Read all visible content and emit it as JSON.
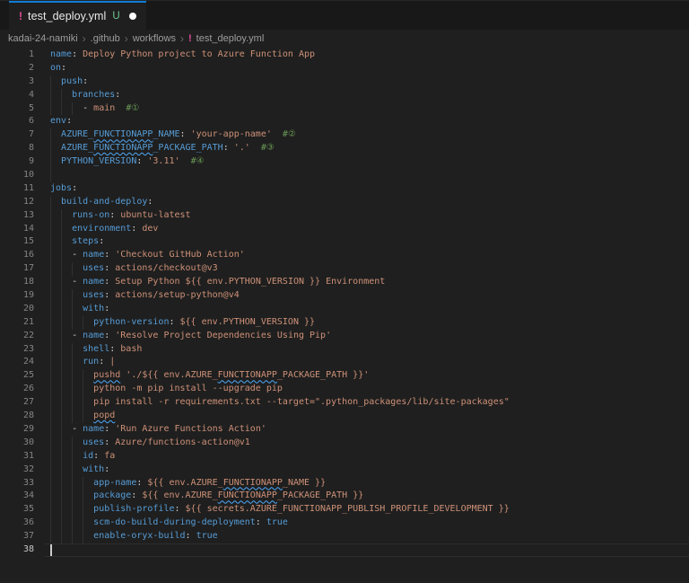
{
  "tab": {
    "icon": "!",
    "label": "test_deploy.yml",
    "git_status": "U"
  },
  "breadcrumb": {
    "separator": "›",
    "items": [
      "kadai-24-namiki",
      ".github",
      "workflows"
    ],
    "file": {
      "icon": "!",
      "label": "test_deploy.yml"
    }
  },
  "colors": {
    "editor_bg": "#1f1f1f",
    "tabbar_bg": "#181818",
    "active_tab_accent": "#0d7cd6",
    "key": "#569cd6",
    "string": "#ce9178",
    "comment": "#6a9955",
    "boolean": "#569cd6",
    "punctuation": "#d4d4d4",
    "squiggle_info": "#4daafc",
    "yaml_icon_pink": "#e64c9c",
    "git_untracked_green": "#73c991",
    "line_number": "#858585",
    "line_number_active": "#c6c6c6"
  },
  "editor": {
    "active_line": 38,
    "lines": [
      {
        "n": 1,
        "g": 0,
        "t": [
          [
            "name",
            "k"
          ],
          [
            ": ",
            "p"
          ],
          [
            "Deploy Python project to Azure Function App",
            "s"
          ]
        ]
      },
      {
        "n": 2,
        "g": 0,
        "t": [
          [
            "on",
            "k"
          ],
          [
            ":",
            "p"
          ]
        ]
      },
      {
        "n": 3,
        "g": 1,
        "t": [
          [
            "  ",
            "w"
          ],
          [
            "push",
            "k"
          ],
          [
            ":",
            "p"
          ]
        ]
      },
      {
        "n": 4,
        "g": 2,
        "t": [
          [
            "    ",
            "w"
          ],
          [
            "branches",
            "k"
          ],
          [
            ":",
            "p"
          ]
        ]
      },
      {
        "n": 5,
        "g": 3,
        "t": [
          [
            "      ",
            "w"
          ],
          [
            "- ",
            "p"
          ],
          [
            "main",
            "s"
          ],
          [
            "  ",
            "w"
          ],
          [
            "#①",
            "c"
          ]
        ]
      },
      {
        "n": 6,
        "g": 0,
        "t": [
          [
            "env",
            "k"
          ],
          [
            ":",
            "p"
          ]
        ]
      },
      {
        "n": 7,
        "g": 1,
        "t": [
          [
            "  ",
            "w"
          ],
          [
            "AZURE_",
            "k"
          ],
          [
            "FUNCTIONAPP",
            "k",
            1
          ],
          [
            "_NAME",
            "k"
          ],
          [
            ": ",
            "p"
          ],
          [
            "'your-app-name'",
            "s"
          ],
          [
            "  ",
            "w"
          ],
          [
            "#②",
            "c"
          ]
        ]
      },
      {
        "n": 8,
        "g": 1,
        "t": [
          [
            "  ",
            "w"
          ],
          [
            "AZURE_",
            "k"
          ],
          [
            "FUNCTIONAPP",
            "k",
            1
          ],
          [
            "_PACKAGE_PATH",
            "k"
          ],
          [
            ": ",
            "p"
          ],
          [
            "'.'",
            "s"
          ],
          [
            "  ",
            "w"
          ],
          [
            "#③",
            "c"
          ]
        ]
      },
      {
        "n": 9,
        "g": 1,
        "t": [
          [
            "  ",
            "w"
          ],
          [
            "PYTHON_VERSION",
            "k"
          ],
          [
            ": ",
            "p"
          ],
          [
            "'3.11'",
            "s"
          ],
          [
            "  ",
            "w"
          ],
          [
            "#④",
            "c"
          ]
        ]
      },
      {
        "n": 10,
        "g": 1,
        "t": []
      },
      {
        "n": 11,
        "g": 0,
        "t": [
          [
            "jobs",
            "k"
          ],
          [
            ":",
            "p"
          ]
        ]
      },
      {
        "n": 12,
        "g": 1,
        "t": [
          [
            "  ",
            "w"
          ],
          [
            "build-and-deploy",
            "k"
          ],
          [
            ":",
            "p"
          ]
        ]
      },
      {
        "n": 13,
        "g": 2,
        "t": [
          [
            "    ",
            "w"
          ],
          [
            "runs-on",
            "k"
          ],
          [
            ": ",
            "p"
          ],
          [
            "ubuntu-latest",
            "s"
          ]
        ]
      },
      {
        "n": 14,
        "g": 2,
        "t": [
          [
            "    ",
            "w"
          ],
          [
            "environment",
            "k"
          ],
          [
            ": ",
            "p"
          ],
          [
            "dev",
            "s"
          ]
        ]
      },
      {
        "n": 15,
        "g": 2,
        "t": [
          [
            "    ",
            "w"
          ],
          [
            "steps",
            "k"
          ],
          [
            ":",
            "p"
          ]
        ]
      },
      {
        "n": 16,
        "g": 2,
        "t": [
          [
            "    ",
            "w"
          ],
          [
            "- ",
            "p"
          ],
          [
            "name",
            "k"
          ],
          [
            ": ",
            "p"
          ],
          [
            "'Checkout GitHub Action'",
            "s"
          ]
        ]
      },
      {
        "n": 17,
        "g": 3,
        "t": [
          [
            "      ",
            "w"
          ],
          [
            "uses",
            "k"
          ],
          [
            ": ",
            "p"
          ],
          [
            "actions/checkout@v3",
            "s"
          ]
        ]
      },
      {
        "n": 18,
        "g": 2,
        "t": [
          [
            "    ",
            "w"
          ],
          [
            "- ",
            "p"
          ],
          [
            "name",
            "k"
          ],
          [
            ": ",
            "p"
          ],
          [
            "Setup Python ${{ env.PYTHON_VERSION }} Environment",
            "s"
          ]
        ]
      },
      {
        "n": 19,
        "g": 3,
        "t": [
          [
            "      ",
            "w"
          ],
          [
            "uses",
            "k"
          ],
          [
            ": ",
            "p"
          ],
          [
            "actions/setup-python@v4",
            "s"
          ]
        ]
      },
      {
        "n": 20,
        "g": 3,
        "t": [
          [
            "      ",
            "w"
          ],
          [
            "with",
            "k"
          ],
          [
            ":",
            "p"
          ]
        ]
      },
      {
        "n": 21,
        "g": 4,
        "t": [
          [
            "        ",
            "w"
          ],
          [
            "python-version",
            "k"
          ],
          [
            ": ",
            "p"
          ],
          [
            "${{ env.PYTHON_VERSION }}",
            "s"
          ]
        ]
      },
      {
        "n": 22,
        "g": 2,
        "t": [
          [
            "    ",
            "w"
          ],
          [
            "- ",
            "p"
          ],
          [
            "name",
            "k"
          ],
          [
            ": ",
            "p"
          ],
          [
            "'Resolve Project Dependencies Using Pip'",
            "s"
          ]
        ]
      },
      {
        "n": 23,
        "g": 3,
        "t": [
          [
            "      ",
            "w"
          ],
          [
            "shell",
            "k"
          ],
          [
            ": ",
            "p"
          ],
          [
            "bash",
            "s"
          ]
        ]
      },
      {
        "n": 24,
        "g": 3,
        "t": [
          [
            "      ",
            "w"
          ],
          [
            "run",
            "k"
          ],
          [
            ": ",
            "p"
          ],
          [
            "|",
            "s"
          ]
        ]
      },
      {
        "n": 25,
        "g": 4,
        "t": [
          [
            "        ",
            "w"
          ],
          [
            "pushd",
            "s",
            1
          ],
          [
            " './${{ env.AZURE_",
            "s"
          ],
          [
            "FUNCTIONAPP",
            "s",
            1
          ],
          [
            "_PACKAGE_PATH }}'",
            "s"
          ]
        ]
      },
      {
        "n": 26,
        "g": 4,
        "t": [
          [
            "        ",
            "w"
          ],
          [
            "python -m pip install --upgrade pip",
            "s"
          ]
        ]
      },
      {
        "n": 27,
        "g": 4,
        "t": [
          [
            "        ",
            "w"
          ],
          [
            "pip install -r requirements.txt --target=\".python_packages/lib/site-packages\"",
            "s"
          ]
        ]
      },
      {
        "n": 28,
        "g": 4,
        "t": [
          [
            "        ",
            "w"
          ],
          [
            "popd",
            "s",
            1
          ]
        ]
      },
      {
        "n": 29,
        "g": 2,
        "t": [
          [
            "    ",
            "w"
          ],
          [
            "- ",
            "p"
          ],
          [
            "name",
            "k"
          ],
          [
            ": ",
            "p"
          ],
          [
            "'Run Azure Functions Action'",
            "s"
          ]
        ]
      },
      {
        "n": 30,
        "g": 3,
        "t": [
          [
            "      ",
            "w"
          ],
          [
            "uses",
            "k"
          ],
          [
            ": ",
            "p"
          ],
          [
            "Azure/functions-action@v1",
            "s"
          ]
        ]
      },
      {
        "n": 31,
        "g": 3,
        "t": [
          [
            "      ",
            "w"
          ],
          [
            "id",
            "k"
          ],
          [
            ": ",
            "p"
          ],
          [
            "fa",
            "s"
          ]
        ]
      },
      {
        "n": 32,
        "g": 3,
        "t": [
          [
            "      ",
            "w"
          ],
          [
            "with",
            "k"
          ],
          [
            ":",
            "p"
          ]
        ]
      },
      {
        "n": 33,
        "g": 4,
        "t": [
          [
            "        ",
            "w"
          ],
          [
            "app-name",
            "k"
          ],
          [
            ": ",
            "p"
          ],
          [
            "${{ env.AZURE_",
            "s"
          ],
          [
            "FUNCTIONAPP",
            "s",
            1
          ],
          [
            "_NAME }}",
            "s"
          ]
        ]
      },
      {
        "n": 34,
        "g": 4,
        "t": [
          [
            "        ",
            "w"
          ],
          [
            "package",
            "k"
          ],
          [
            ": ",
            "p"
          ],
          [
            "${{ env.AZURE_",
            "s"
          ],
          [
            "FUNCTIONAPP",
            "s",
            1
          ],
          [
            "_PACKAGE_PATH }}",
            "s"
          ]
        ]
      },
      {
        "n": 35,
        "g": 4,
        "t": [
          [
            "        ",
            "w"
          ],
          [
            "publish-profile",
            "k"
          ],
          [
            ": ",
            "p"
          ],
          [
            "${{ secrets.AZURE_FUNCTIONAPP_PUBLISH_PROFILE_DEVELOPMENT }}",
            "s"
          ]
        ]
      },
      {
        "n": 36,
        "g": 4,
        "t": [
          [
            "        ",
            "w"
          ],
          [
            "scm-do-build-during-deployment",
            "k"
          ],
          [
            ": ",
            "p"
          ],
          [
            "true",
            "b"
          ]
        ]
      },
      {
        "n": 37,
        "g": 4,
        "t": [
          [
            "        ",
            "w"
          ],
          [
            "enable-oryx-build",
            "k"
          ],
          [
            ": ",
            "p"
          ],
          [
            "true",
            "b"
          ]
        ]
      },
      {
        "n": 38,
        "g": 0,
        "t": [],
        "cursor": true
      }
    ]
  }
}
